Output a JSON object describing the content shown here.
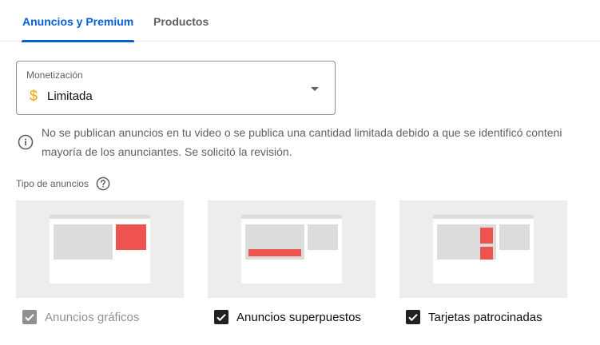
{
  "tabs": [
    {
      "label": "Anuncios y Premium",
      "active": true
    },
    {
      "label": "Productos",
      "active": false
    }
  ],
  "monetization": {
    "label": "Monetización",
    "icon": "dollar-icon",
    "icon_glyph": "$",
    "icon_color": "#f2a600",
    "value": "Limitada"
  },
  "info": {
    "icon": "info-icon",
    "line1": "No se publican anuncios en tu video o se publica una cantidad limitada debido a que se identificó conteni",
    "line2": "mayoría de los anunciantes. Se solicitó la revisión."
  },
  "ad_types": {
    "label": "Tipo de anuncios",
    "help_icon": "help-icon",
    "items": [
      {
        "label": "Anuncios gráficos",
        "checked": true,
        "disabled": true
      },
      {
        "label": "Anuncios superpuestos",
        "checked": true,
        "disabled": false
      },
      {
        "label": "Tarjetas patrocinadas",
        "checked": true,
        "disabled": false
      }
    ]
  },
  "colors": {
    "accent": "#065fd4",
    "ad_highlight": "#ef5350",
    "card_bg": "#ededed",
    "placeholder": "#dcdcdc"
  }
}
